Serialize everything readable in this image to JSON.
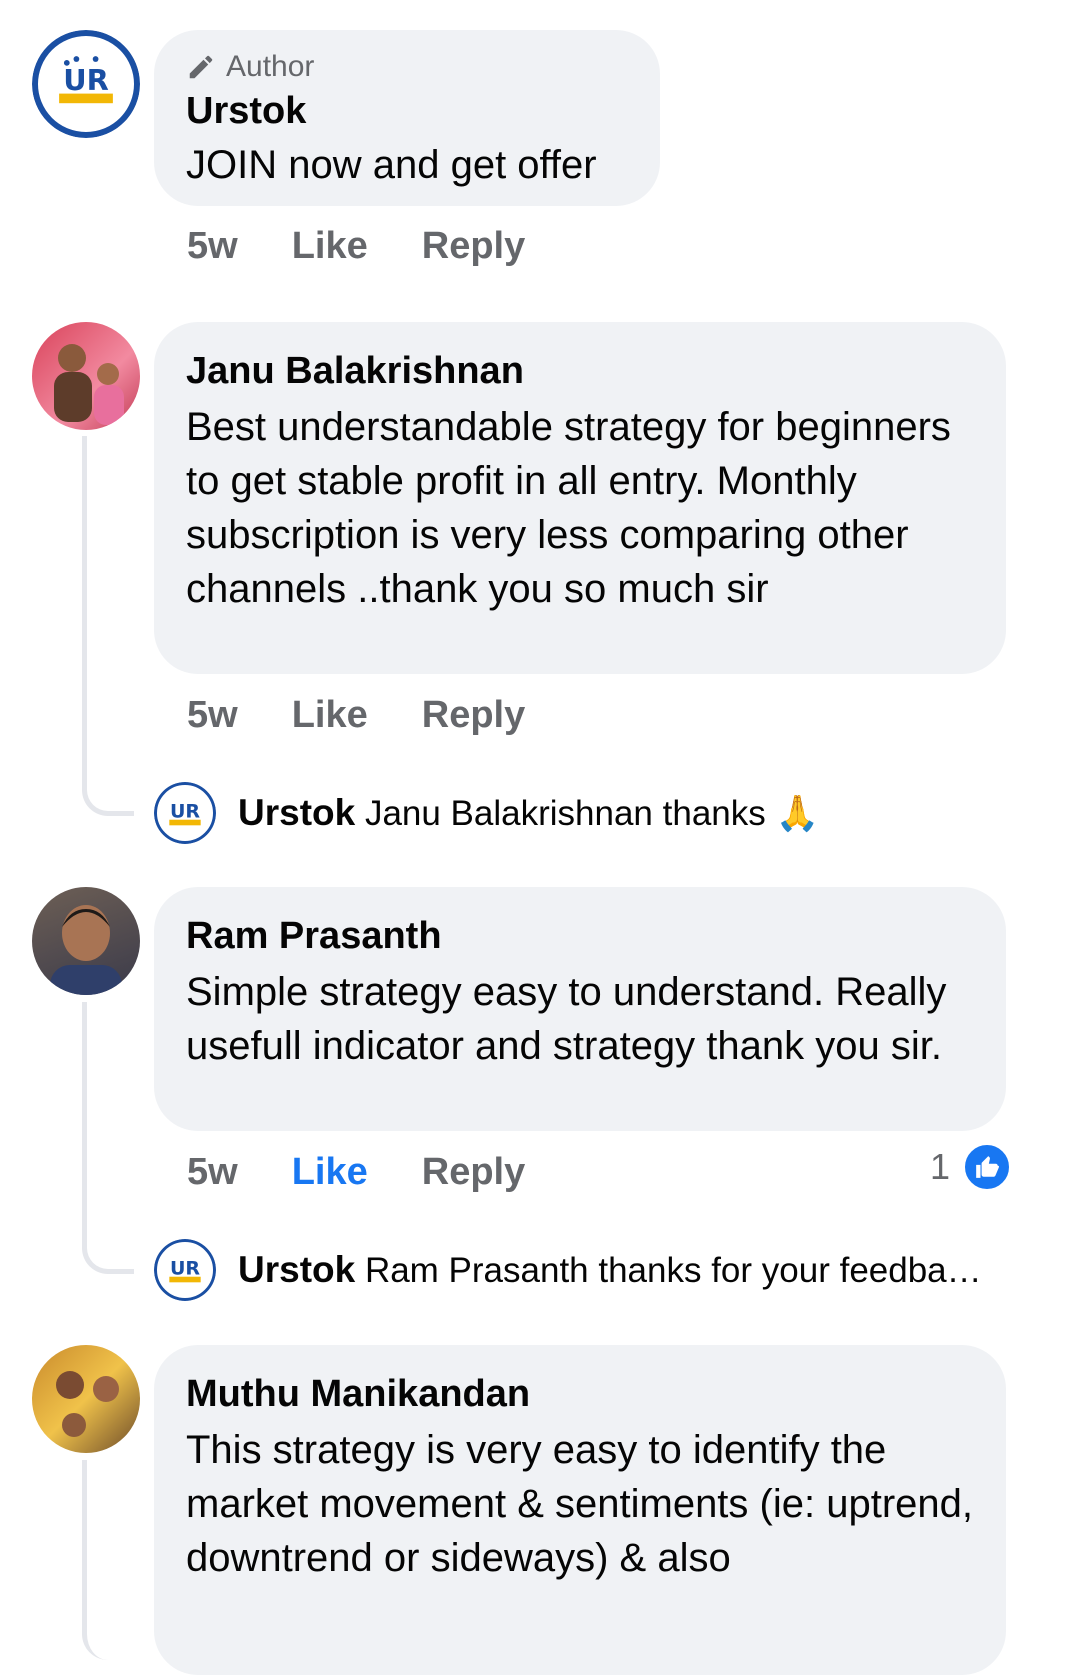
{
  "comments": [
    {
      "author_badge": "Author",
      "name": "Urstok",
      "text": "JOIN now and get offer",
      "time": "5w",
      "like": "Like",
      "reply": "Reply"
    },
    {
      "name": "Janu Balakrishnan",
      "text": "Best understandable strategy for beginners to get stable profit in all entry. Monthly subscription is very less comparing other channels ..thank you so much sir",
      "time": "5w",
      "like": "Like",
      "reply": "Reply",
      "reply_preview": {
        "name": "Urstok",
        "text": "Janu Balakrishnan thanks",
        "emoji": "🙏"
      }
    },
    {
      "name": "Ram Prasanth",
      "text": "Simple strategy easy to understand. Really usefull indicator and strategy thank you sir.",
      "time": "5w",
      "like": "Like",
      "reply": "Reply",
      "reaction_count": "1",
      "liked": true,
      "reply_preview": {
        "name": "Urstok",
        "text": "Ram Prasanth thanks for your feedback…"
      }
    },
    {
      "name": "Muthu Manikandan",
      "text": "This strategy is very easy to identify the market movement & sentiments (ie: uptrend, downtrend or sideways) & also"
    }
  ],
  "colors": {
    "bubble": "#f0f2f5",
    "secondary_text": "#65676b",
    "like_blue": "#1877f2",
    "logo_blue": "#1a4fa3"
  },
  "icons": [
    "pencil-icon",
    "urstok-logo",
    "like-thumb-icon",
    "folded-hands-emoji"
  ]
}
